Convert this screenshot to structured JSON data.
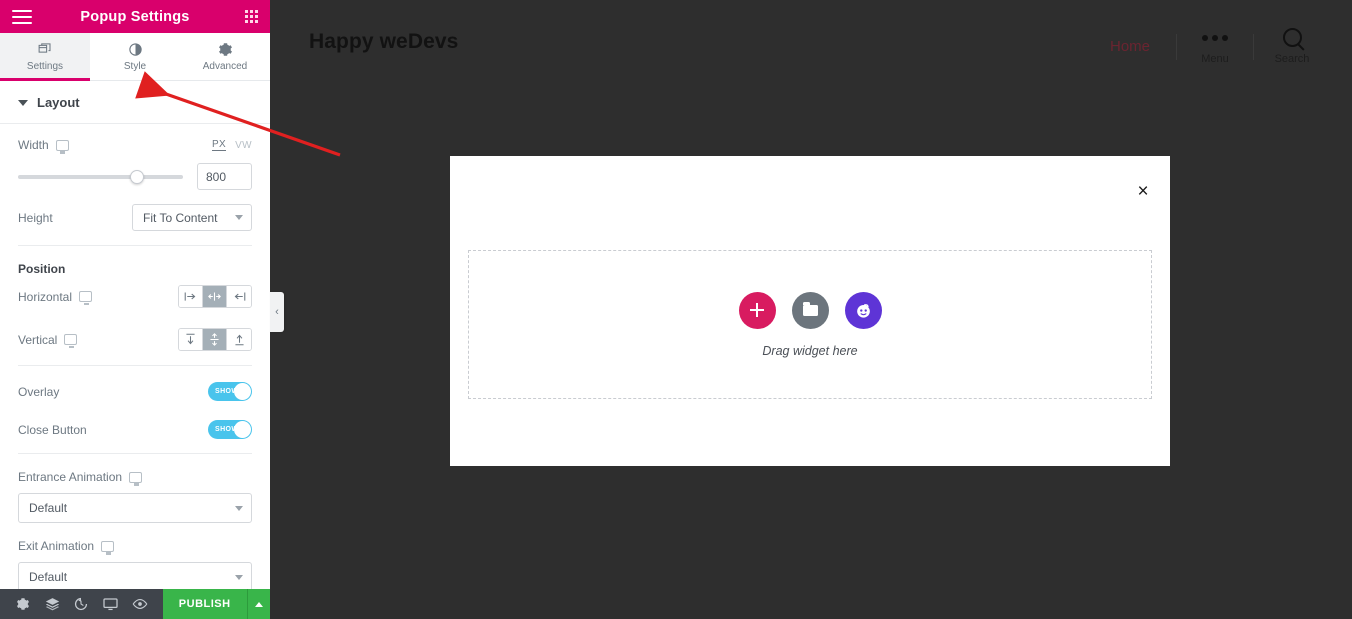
{
  "panel": {
    "header": {
      "title": "Popup Settings",
      "menu_icon": "hamburger-icon",
      "grid_icon": "grid-icon"
    },
    "tabs": [
      {
        "label": "Settings",
        "icon": "windows-icon",
        "active": true
      },
      {
        "label": "Style",
        "icon": "contrast-icon",
        "active": false
      },
      {
        "label": "Advanced",
        "icon": "gear-icon",
        "active": false
      }
    ],
    "sections": {
      "layout": {
        "title": "Layout",
        "width": {
          "label": "Width",
          "value": "800",
          "units": [
            {
              "label": "PX",
              "active": true
            },
            {
              "label": "VW",
              "active": false
            }
          ]
        },
        "height": {
          "label": "Height",
          "value": "Fit To Content"
        },
        "position": {
          "title": "Position",
          "horizontal": {
            "label": "Horizontal",
            "options": [
              "align-left",
              "align-center",
              "align-right"
            ],
            "selected": 1
          },
          "vertical": {
            "label": "Vertical",
            "options": [
              "align-top",
              "align-middle",
              "align-bottom"
            ],
            "selected": 1
          }
        },
        "overlay": {
          "label": "Overlay",
          "toggle_text": "SHOW",
          "on": true
        },
        "close_button": {
          "label": "Close Button",
          "toggle_text": "SHOW",
          "on": true
        },
        "entrance_animation": {
          "label": "Entrance Animation",
          "value": "Default"
        },
        "exit_animation": {
          "label": "Exit Animation",
          "value": "Default"
        }
      }
    },
    "bottom_bar": {
      "icons": [
        "gear-icon",
        "layers-icon",
        "history-icon",
        "responsive-icon",
        "preview-eye-icon"
      ],
      "publish_label": "PUBLISH"
    },
    "collapse_handle": "‹"
  },
  "canvas": {
    "site_title": "Happy weDevs",
    "nav": {
      "home_label": "Home",
      "menu_label": "Menu",
      "search_label": "Search"
    },
    "popup": {
      "close_icon": "×",
      "dropzone_text": "Drag widget here",
      "widget_buttons": [
        {
          "name": "add-widget-button",
          "icon": "plus-icon",
          "color": "#d81b60"
        },
        {
          "name": "template-library-button",
          "icon": "folder-icon",
          "color": "#6c757d"
        },
        {
          "name": "ai-widget-button",
          "icon": "robot-face-icon",
          "color": "#5e34d6"
        }
      ]
    }
  },
  "annotation": {
    "arrow_color": "#e02020"
  },
  "colors": {
    "brand_pink": "#d9006c",
    "toggle_on": "#49c4ec",
    "publish_green": "#39b54a",
    "canvas_dark": "#2e2e2e"
  }
}
